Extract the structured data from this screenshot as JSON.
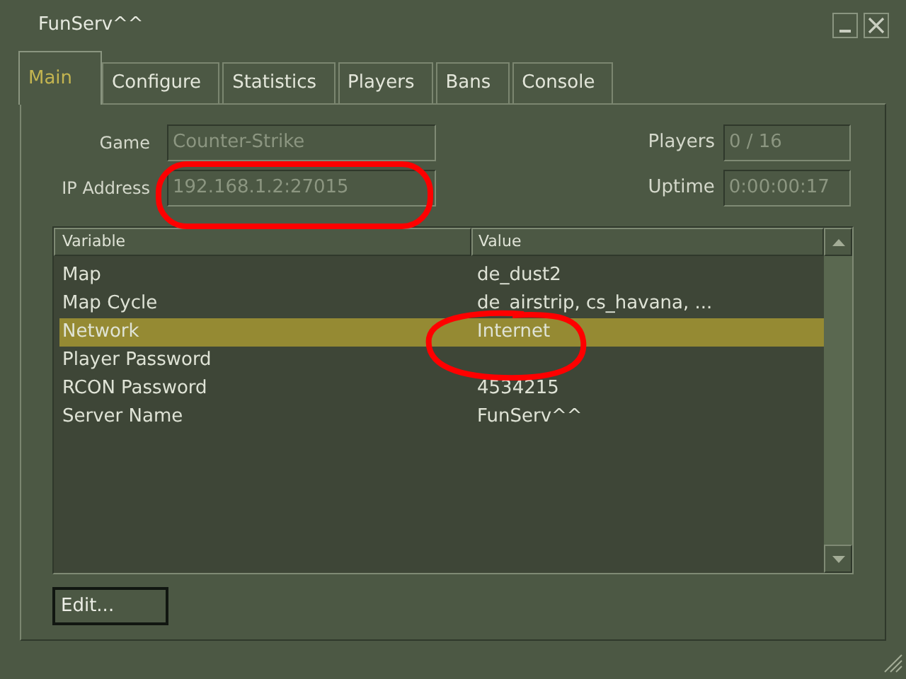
{
  "window": {
    "title": "FunServ^^"
  },
  "tabs": [
    {
      "label": "Main",
      "selected": true
    },
    {
      "label": "Configure",
      "selected": false
    },
    {
      "label": "Statistics",
      "selected": false
    },
    {
      "label": "Players",
      "selected": false
    },
    {
      "label": "Bans",
      "selected": false
    },
    {
      "label": "Console",
      "selected": false
    }
  ],
  "fields_left": [
    {
      "label": "Game",
      "value": "Counter-Strike"
    },
    {
      "label": "IP Address",
      "value": "192.168.1.2:27015"
    }
  ],
  "fields_right": [
    {
      "label": "Players",
      "value": "0 / 16"
    },
    {
      "label": "Uptime",
      "value": "0:00:00:17"
    }
  ],
  "table": {
    "columns": [
      "Variable",
      "Value"
    ],
    "rows": [
      {
        "cells": [
          "Map",
          "de_dust2"
        ],
        "selected": false
      },
      {
        "cells": [
          "Map Cycle",
          "de_airstrip, cs_havana, ..."
        ],
        "selected": false
      },
      {
        "cells": [
          "Network",
          "Internet"
        ],
        "selected": true
      },
      {
        "cells": [
          "Player Password",
          ""
        ],
        "selected": false
      },
      {
        "cells": [
          "RCON Password",
          "4534215"
        ],
        "selected": false
      },
      {
        "cells": [
          "Server Name",
          "FunServ^^"
        ],
        "selected": false
      }
    ]
  },
  "buttons": [
    "Edit..."
  ]
}
